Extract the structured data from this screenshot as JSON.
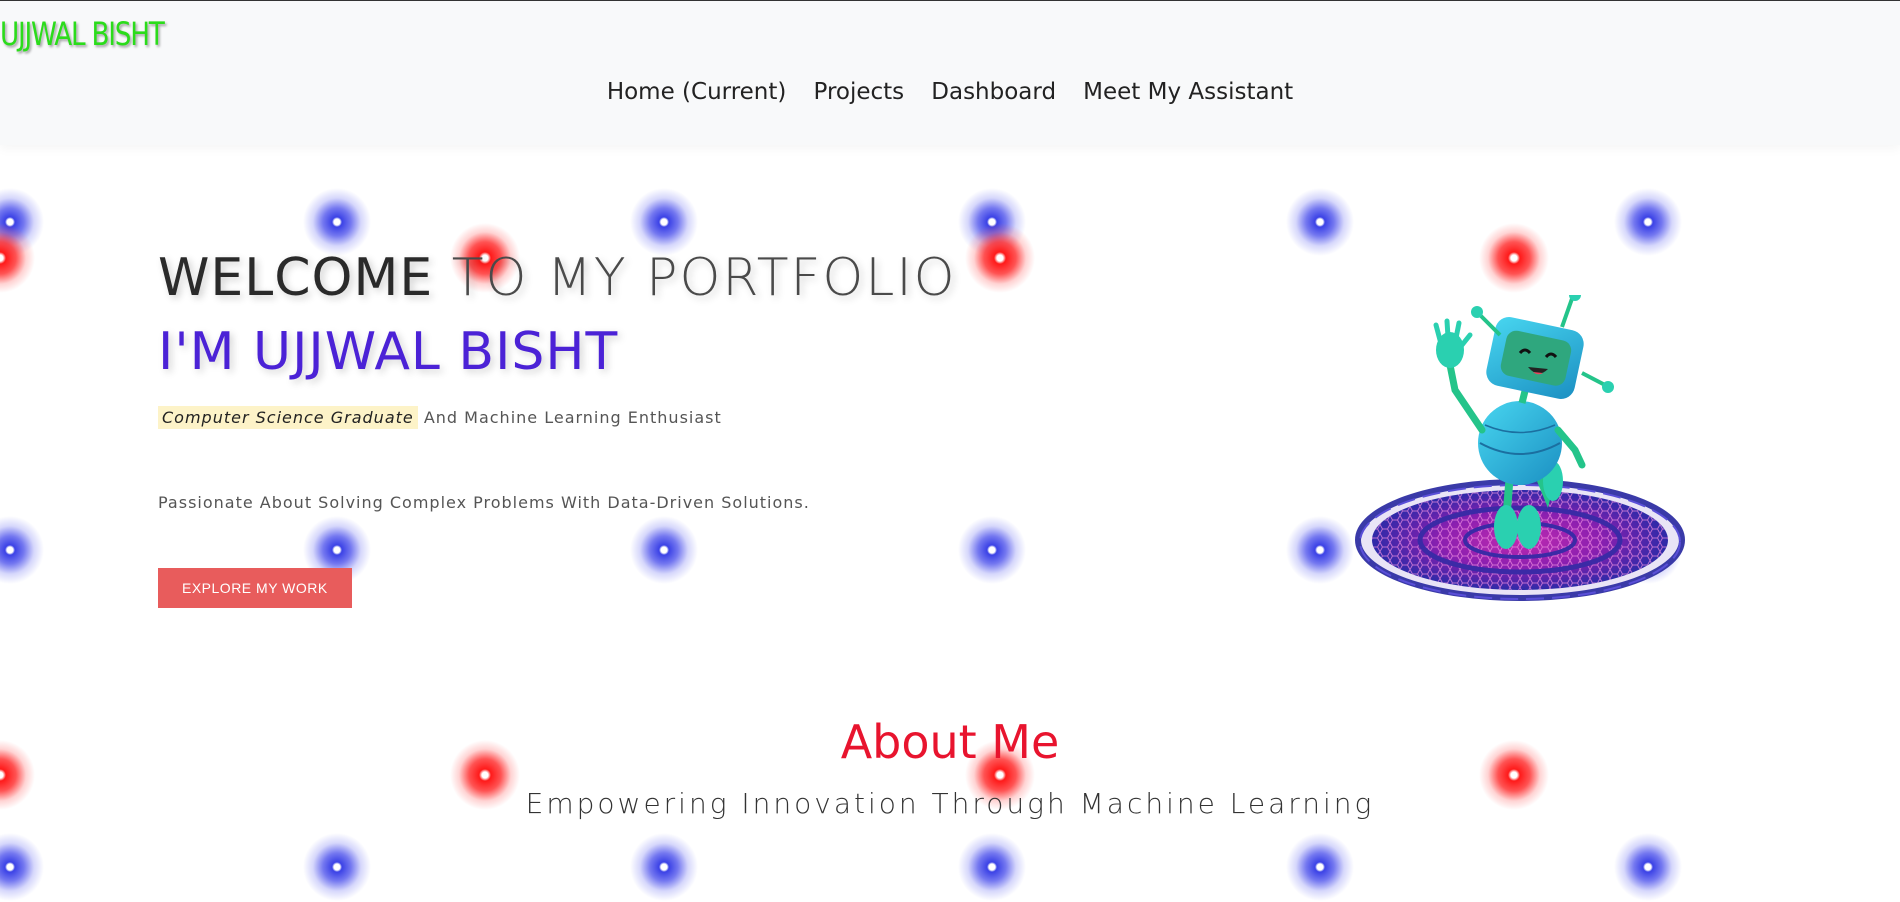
{
  "header": {
    "brand": "UJJWAL BISHT",
    "nav": [
      {
        "label": "Home (Current)"
      },
      {
        "label": "Projects"
      },
      {
        "label": "Dashboard"
      },
      {
        "label": "Meet My Assistant"
      }
    ]
  },
  "hero": {
    "welcome_bold": "WELCOME",
    "welcome_light": " TO MY PORTFOLIO",
    "name": "I'M UJJWAL BISHT",
    "highlight": "Computer Science Graduate",
    "tagline_rest": " And Machine Learning Enthusiast",
    "passion": "Passionate About Solving Complex Problems With Data-Driven Solutions.",
    "cta_label": "EXPLORE MY WORK",
    "illustration_icon": "waving-robot-icon"
  },
  "about": {
    "title": "About Me",
    "subtitle": "Empowering Innovation Through Machine Learning"
  },
  "colors": {
    "brand": "#2bdc1b",
    "name": "#4b22d6",
    "cta": "#e85c5c",
    "about_title": "#e8142e",
    "dot_blue": "#3b42e6",
    "dot_red": "#ff1a1a"
  }
}
